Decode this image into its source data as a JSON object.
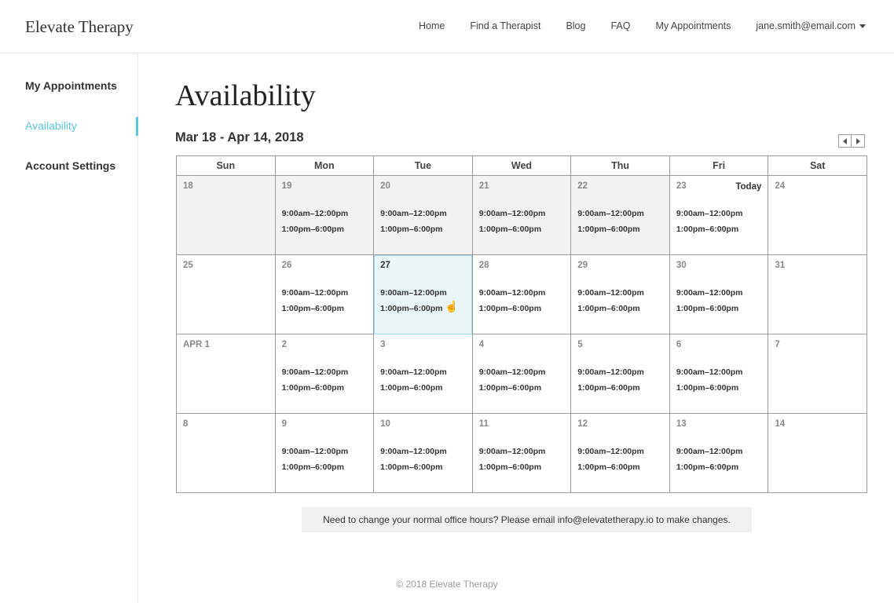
{
  "brand": {
    "name": "Elevate Therapy"
  },
  "nav": {
    "items": [
      "Home",
      "Find a Therapist",
      "Blog",
      "FAQ",
      "My Appointments"
    ],
    "user_email": "jane.smith@email.com"
  },
  "sidebar": {
    "items": [
      {
        "label": "My Appointments",
        "active": false
      },
      {
        "label": "Availability",
        "active": true
      },
      {
        "label": "Account Settings",
        "active": false
      }
    ]
  },
  "page": {
    "title": "Availability",
    "range": "Mar 18 - Apr 14, 2018"
  },
  "calendar": {
    "weekdays": [
      "Sun",
      "Mon",
      "Tue",
      "Wed",
      "Thu",
      "Fri",
      "Sat"
    ],
    "today_label": "Today",
    "weeks": [
      [
        {
          "day": "18",
          "past": true,
          "slots": []
        },
        {
          "day": "19",
          "past": true,
          "slots": [
            "9:00am–12:00pm",
            "1:00pm–6:00pm"
          ]
        },
        {
          "day": "20",
          "past": true,
          "slots": [
            "9:00am–12:00pm",
            "1:00pm–6:00pm"
          ]
        },
        {
          "day": "21",
          "past": true,
          "slots": [
            "9:00am–12:00pm",
            "1:00pm–6:00pm"
          ]
        },
        {
          "day": "22",
          "past": true,
          "slots": [
            "9:00am–12:00pm",
            "1:00pm–6:00pm"
          ]
        },
        {
          "day": "23",
          "today": true,
          "slots": [
            "9:00am–12:00pm",
            "1:00pm–6:00pm"
          ]
        },
        {
          "day": "24",
          "slots": []
        }
      ],
      [
        {
          "day": "25",
          "slots": []
        },
        {
          "day": "26",
          "slots": [
            "9:00am–12:00pm",
            "1:00pm–6:00pm"
          ]
        },
        {
          "day": "27",
          "selected": true,
          "slots": [
            "9:00am–12:00pm",
            "1:00pm–6:00pm"
          ]
        },
        {
          "day": "28",
          "slots": [
            "9:00am–12:00pm",
            "1:00pm–6:00pm"
          ]
        },
        {
          "day": "29",
          "slots": [
            "9:00am–12:00pm",
            "1:00pm–6:00pm"
          ]
        },
        {
          "day": "30",
          "slots": [
            "9:00am–12:00pm",
            "1:00pm–6:00pm"
          ]
        },
        {
          "day": "31",
          "slots": []
        }
      ],
      [
        {
          "day": "APR 1",
          "slots": []
        },
        {
          "day": "2",
          "slots": [
            "9:00am–12:00pm",
            "1:00pm–6:00pm"
          ]
        },
        {
          "day": "3",
          "slots": [
            "9:00am–12:00pm",
            "1:00pm–6:00pm"
          ]
        },
        {
          "day": "4",
          "slots": [
            "9:00am–12:00pm",
            "1:00pm–6:00pm"
          ]
        },
        {
          "day": "5",
          "slots": [
            "9:00am–12:00pm",
            "1:00pm–6:00pm"
          ]
        },
        {
          "day": "6",
          "slots": [
            "9:00am–12:00pm",
            "1:00pm–6:00pm"
          ]
        },
        {
          "day": "7",
          "slots": []
        }
      ],
      [
        {
          "day": "8",
          "slots": []
        },
        {
          "day": "9",
          "slots": [
            "9:00am–12:00pm",
            "1:00pm–6:00pm"
          ]
        },
        {
          "day": "10",
          "slots": [
            "9:00am–12:00pm",
            "1:00pm–6:00pm"
          ]
        },
        {
          "day": "11",
          "slots": [
            "9:00am–12:00pm",
            "1:00pm–6:00pm"
          ]
        },
        {
          "day": "12",
          "slots": [
            "9:00am–12:00pm",
            "1:00pm–6:00pm"
          ]
        },
        {
          "day": "13",
          "slots": [
            "9:00am–12:00pm",
            "1:00pm–6:00pm"
          ]
        },
        {
          "day": "14",
          "slots": []
        }
      ]
    ]
  },
  "notice": "Need to change your normal office hours? Please email info@elevatetherapy.io to make changes.",
  "footer": "© 2018 Elevate Therapy",
  "colors": {
    "accent": "#5bc6dc",
    "selected_bg": "#e9f6f9",
    "past_bg": "#f2f2f2"
  }
}
